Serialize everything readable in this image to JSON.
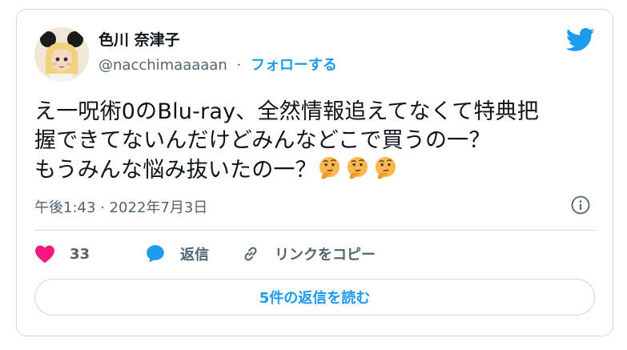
{
  "author": {
    "display_name": "色川 奈津子",
    "handle": "@nacchimaaaaan",
    "separator": "·",
    "follow_label": "フォローする"
  },
  "tweet": {
    "lines": [
      "え一呪術0のBlu-ray、全然情報追えてなくて特典把",
      "握できてないんだけどみんなどこで買うの一？",
      "もうみんな悩み抜いたの一？"
    ],
    "trailing_emoji": [
      "thinking-face",
      "thinking-face",
      "thinking-face"
    ],
    "timestamp": "午後1:43 · 2022年7月3日"
  },
  "actions": {
    "like_count": "33",
    "reply_label": "返信",
    "copy_link_label": "リンクをコピー"
  },
  "read_replies_label": "5件の返信を読む",
  "colors": {
    "twitter_blue": "#1d9bf0",
    "like_red": "#f91880",
    "muted_text": "#536471",
    "border": "#cfd9de"
  },
  "icons": [
    "twitter-bird-icon",
    "info-icon",
    "heart-icon",
    "reply-bubble-icon",
    "link-icon"
  ]
}
